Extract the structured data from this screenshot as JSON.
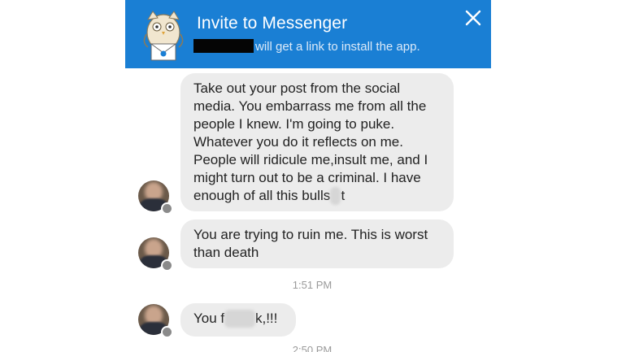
{
  "banner": {
    "title": "Invite to Messenger",
    "subtitle": "will get a link to install the app.",
    "background": "#1a7fd4",
    "close_icon": "close-icon"
  },
  "messages": [
    {
      "text": "Take out your post from the social media. You embarrass me from all the people I knew. I'm going to puke. Whatever you do it reflects on me. People will ridicule me,insult me, and I might turn out to be a criminal. I have enough of all this bulls",
      "censored": "hi",
      "text_end": "t"
    },
    {
      "text": "You are trying to ruin me. This is worst than death"
    },
    {
      "text": "You f",
      "censored": "uuuu",
      "text_end": "k,!!!"
    }
  ],
  "timestamps": [
    "1:51 PM",
    "2:50 PM"
  ],
  "colors": {
    "bubble": "#ececec",
    "timestamp": "#9a9a9a"
  }
}
